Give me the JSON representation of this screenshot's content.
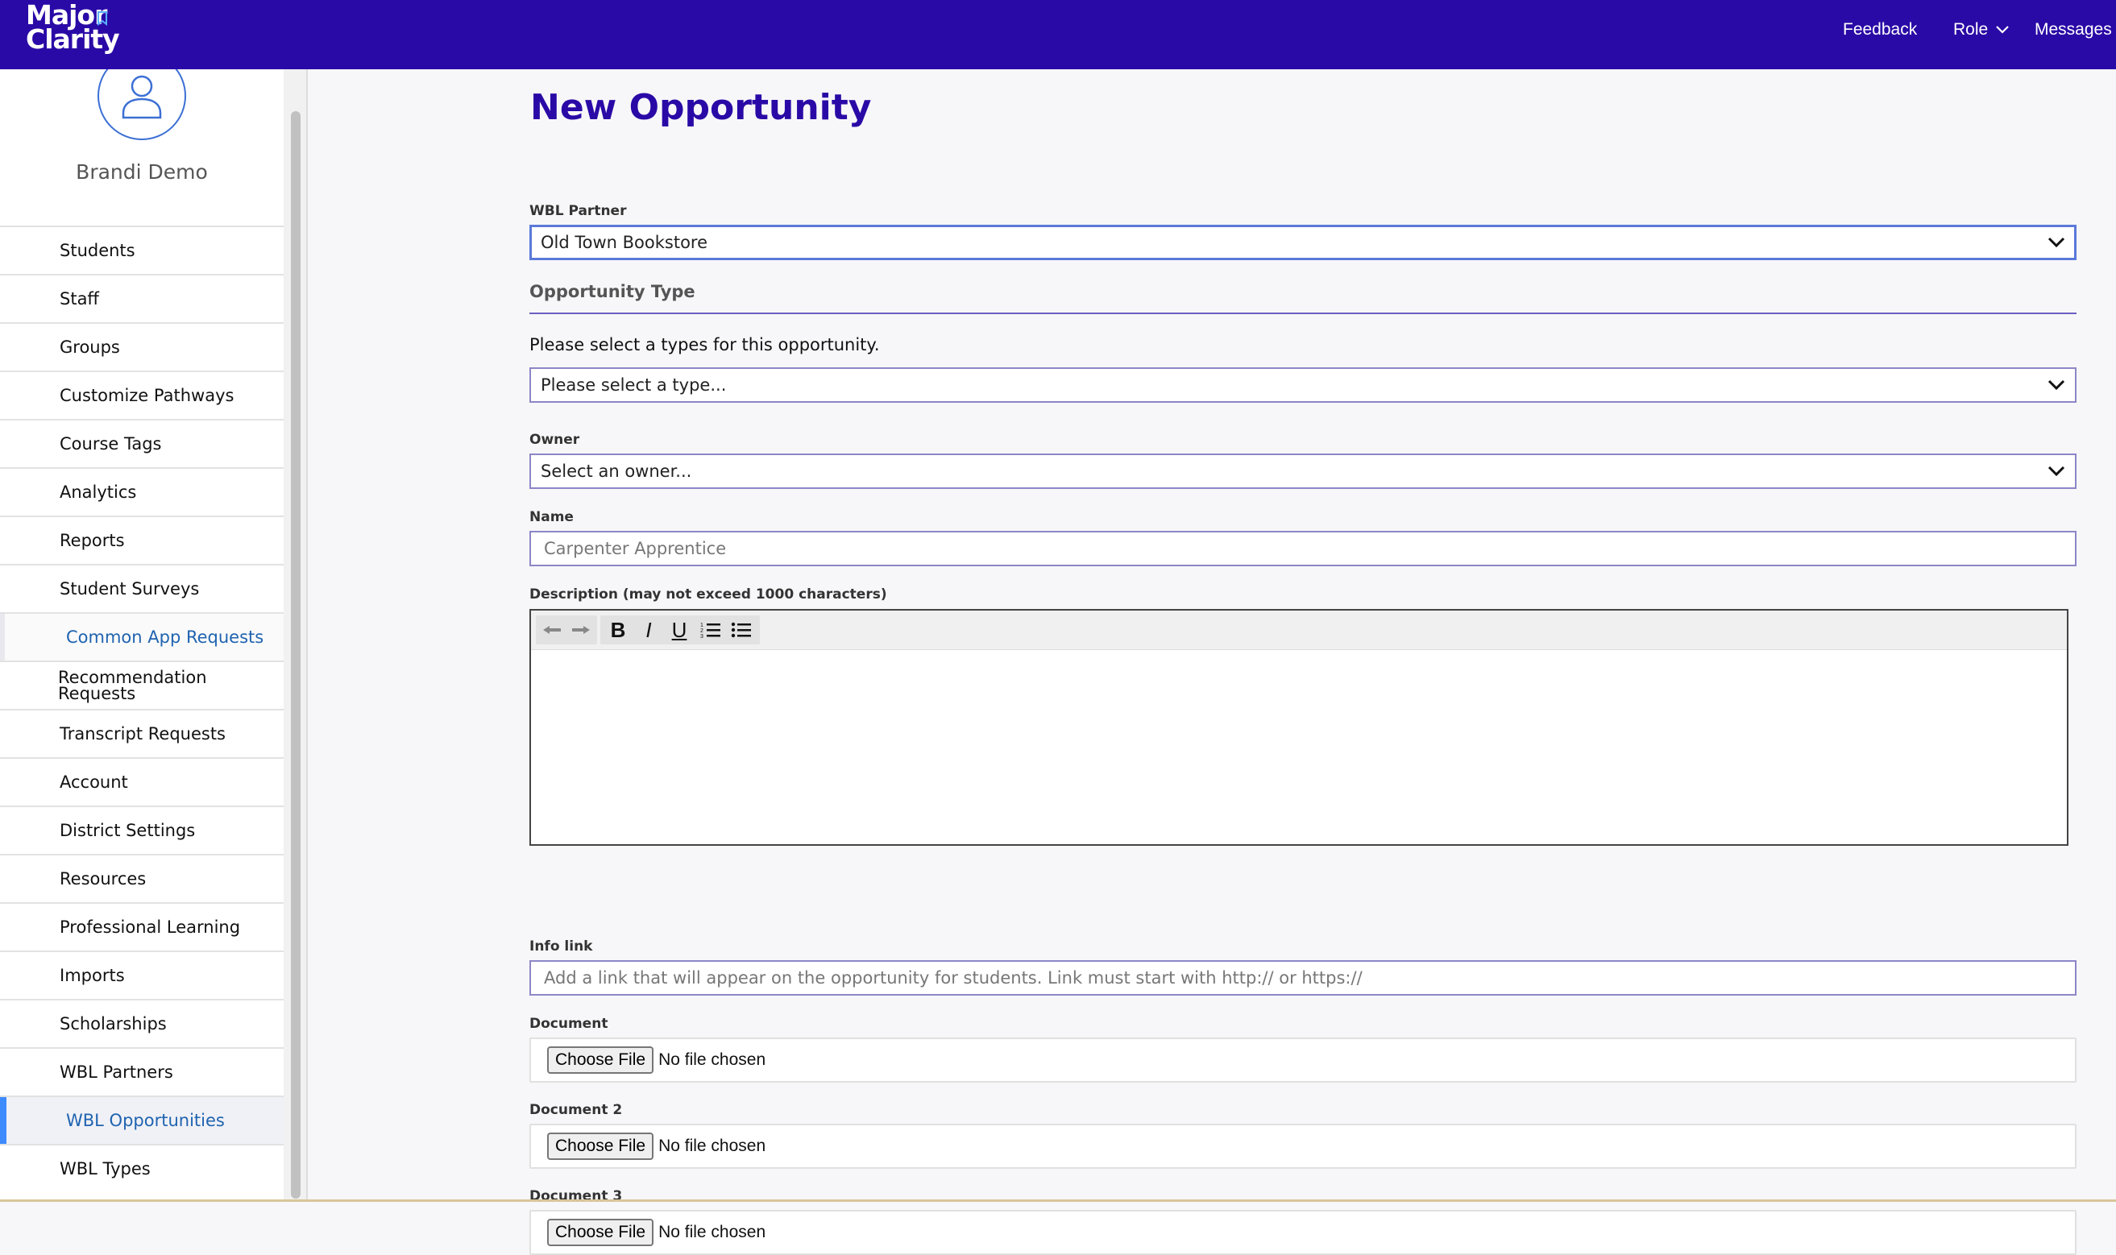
{
  "brand": {
    "line1": "Major",
    "line2": "Clarity"
  },
  "topnav": {
    "feedback": "Feedback",
    "role": "Role",
    "messages": "Messages"
  },
  "user": {
    "name": "Brandi Demo"
  },
  "sidebar": {
    "items": [
      {
        "label": "Students"
      },
      {
        "label": "Staff"
      },
      {
        "label": "Groups"
      },
      {
        "label": "Customize Pathways"
      },
      {
        "label": "Course Tags"
      },
      {
        "label": "Analytics"
      },
      {
        "label": "Reports"
      },
      {
        "label": "Student Surveys"
      },
      {
        "label": "Common App Requests"
      },
      {
        "label": "Recommendation Requests"
      },
      {
        "label": "Transcript Requests"
      },
      {
        "label": "Account"
      },
      {
        "label": "District Settings"
      },
      {
        "label": "Resources"
      },
      {
        "label": "Professional Learning"
      },
      {
        "label": "Imports"
      },
      {
        "label": "Scholarships"
      },
      {
        "label": "WBL Partners"
      },
      {
        "label": "WBL Opportunities"
      },
      {
        "label": "WBL Types"
      }
    ]
  },
  "form": {
    "title": "New Opportunity",
    "wbl_partner": {
      "label": "WBL Partner",
      "value": "Old Town Bookstore"
    },
    "opportunity_type": {
      "section": "Opportunity Type",
      "helper": "Please select a types for this opportunity.",
      "placeholder": "Please select a type..."
    },
    "owner": {
      "label": "Owner",
      "placeholder": "Select an owner..."
    },
    "name": {
      "label": "Name",
      "placeholder": "Carpenter Apprentice"
    },
    "description": {
      "label": "Description (may not exceed 1000 characters)"
    },
    "info_link": {
      "label": "Info link",
      "placeholder": "Add a link that will appear on the opportunity for students. Link must start with http:// or https://"
    },
    "documents": [
      {
        "label": "Document",
        "button": "Choose File",
        "status": "No file chosen"
      },
      {
        "label": "Document 2",
        "button": "Choose File",
        "status": "No file chosen"
      },
      {
        "label": "Document 3",
        "button": "Choose File",
        "status": "No file chosen"
      }
    ]
  },
  "colors": {
    "brand": "#2a0aa6",
    "link": "#1f63b0",
    "active_marker": "#3d8bff"
  },
  "icons": [
    "user-avatar-icon",
    "chevron-down-icon",
    "undo-icon",
    "redo-icon",
    "bold-icon",
    "italic-icon",
    "underline-icon",
    "ordered-list-icon",
    "bulleted-list-icon"
  ]
}
